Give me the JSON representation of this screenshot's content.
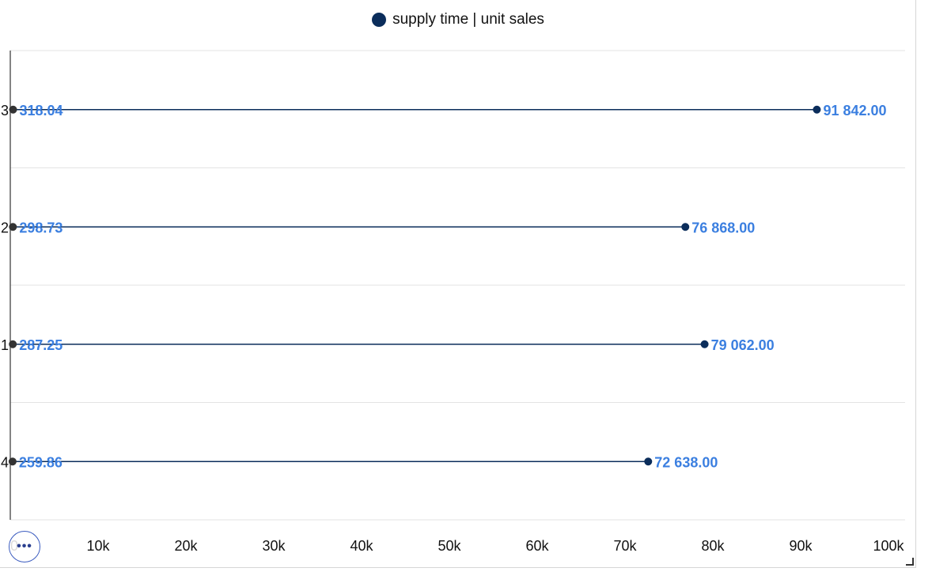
{
  "legend": {
    "label": "supply time | unit sales",
    "color": "#0b2d5b"
  },
  "colors": {
    "line": "#0b2d5b",
    "start_point": "#333333",
    "label": "#3b7fe0",
    "grid": "#e3e3e3",
    "axis": "#333333"
  },
  "chart_data": {
    "type": "dumbbell",
    "title": "",
    "xlabel": "",
    "ylabel": "",
    "xlim": [
      0,
      100000
    ],
    "x_ticks": [
      "0",
      "10k",
      "20k",
      "30k",
      "40k",
      "50k",
      "60k",
      "70k",
      "80k",
      "90k",
      "100k"
    ],
    "x_tick_values": [
      0,
      10000,
      20000,
      30000,
      40000,
      50000,
      60000,
      70000,
      80000,
      90000,
      100000
    ],
    "categories": [
      "3",
      "2",
      "1",
      "4"
    ],
    "series": [
      {
        "name": "supply time | unit sales",
        "low": [
          318.04,
          298.73,
          287.25,
          259.86
        ],
        "high": [
          91842,
          76868,
          79062,
          72638
        ],
        "low_labels": [
          "318.04",
          "298.73",
          "287.25",
          "259.86"
        ],
        "high_labels": [
          "91 842.00",
          "76 868.00",
          "79 062.00",
          "72 638.00"
        ]
      }
    ],
    "grid": true,
    "legend_position": "top-center"
  },
  "controls": {
    "more_label": "•••"
  }
}
